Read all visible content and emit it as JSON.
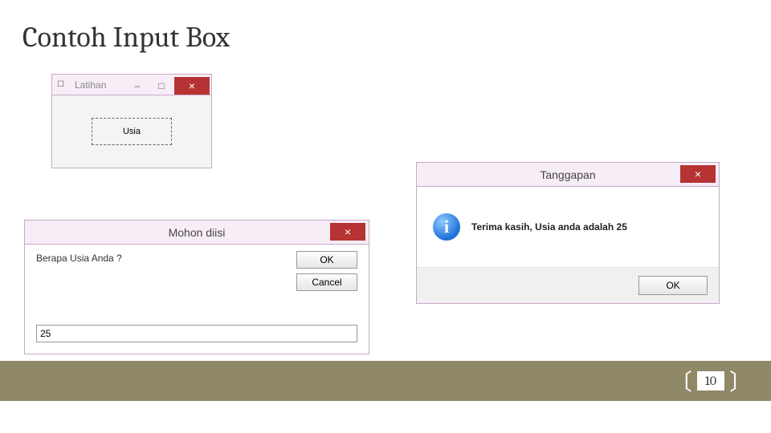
{
  "slide": {
    "title": "Contoh Input Box",
    "page_number": "10"
  },
  "form_window": {
    "title": "Latihan",
    "button_label": "Usia",
    "close_glyph": "×",
    "min_glyph": "–",
    "max_glyph": "□"
  },
  "input_box": {
    "title": "Mohon diisi",
    "prompt": "Berapa Usia Anda ?",
    "value": "25",
    "ok_label": "OK",
    "cancel_label": "Cancel",
    "close_glyph": "×"
  },
  "msg_box": {
    "title": "Tanggapan",
    "message": "Terima kasih, Usia anda adalah 25",
    "ok_label": "OK",
    "close_glyph": "×",
    "info_glyph": "i"
  }
}
